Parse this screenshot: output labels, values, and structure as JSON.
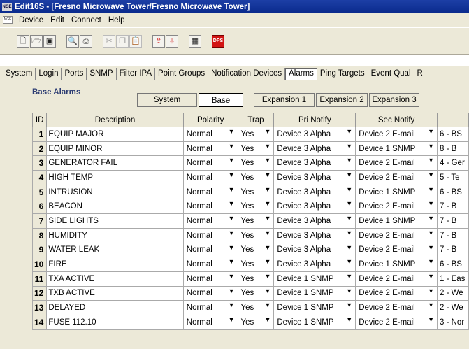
{
  "window": {
    "title": "Edit16S - [Fresno Microwave Tower/Fresno Microwave Tower]",
    "app_icon_text": "NGE"
  },
  "menu": {
    "icon_text": "NGE",
    "items": [
      "Device",
      "Edit",
      "Connect",
      "Help"
    ]
  },
  "toolbar": {
    "groups": [
      [
        {
          "icon": "new-file-icon",
          "glyph": "🗋"
        },
        {
          "icon": "open-folder-icon",
          "glyph": "🗁"
        },
        {
          "icon": "save-icon",
          "glyph": "▣"
        }
      ],
      [
        {
          "icon": "print-preview-icon",
          "glyph": "🔍"
        },
        {
          "icon": "print-icon",
          "glyph": "⎙"
        }
      ],
      [
        {
          "icon": "cut-icon",
          "glyph": "✂",
          "dim": true
        },
        {
          "icon": "copy-icon",
          "glyph": "❐",
          "dim": true
        },
        {
          "icon": "paste-icon",
          "glyph": "📋",
          "dim": true
        }
      ],
      [
        {
          "icon": "upload-icon",
          "glyph": "⇪",
          "red": true
        },
        {
          "icon": "download-icon",
          "glyph": "⇩",
          "red": true
        }
      ],
      [
        {
          "icon": "network-icon",
          "glyph": "▦"
        }
      ],
      [
        {
          "icon": "dps-logo-icon",
          "glyph": "DPS",
          "dps": true
        }
      ]
    ]
  },
  "tabs": [
    "System",
    "Login",
    "Ports",
    "SNMP",
    "Filter IPA",
    "Point Groups",
    "Notification Devices",
    "Alarms",
    "Ping Targets",
    "Event Qual",
    "R"
  ],
  "active_tab": "Alarms",
  "section_title": "Base Alarms",
  "segments": [
    "System",
    "Base",
    "Expansion 1",
    "Expansion 2",
    "Expansion 3"
  ],
  "active_segment": "Base",
  "columns": [
    "ID",
    "Description",
    "Polarity",
    "Trap",
    "Pri Notify",
    "Sec Notify",
    ""
  ],
  "rows": [
    {
      "id": "1",
      "desc": "EQUIP MAJOR",
      "polarity": "Normal",
      "trap": "Yes",
      "pri": "Device 3 Alpha",
      "sec": "Device 2 E-mail",
      "more": "6 - BS"
    },
    {
      "id": "2",
      "desc": "EQUIP MINOR",
      "polarity": "Normal",
      "trap": "Yes",
      "pri": "Device 3 Alpha",
      "sec": "Device 1 SNMP",
      "more": "8 - B"
    },
    {
      "id": "3",
      "desc": "GENERATOR FAIL",
      "polarity": "Normal",
      "trap": "Yes",
      "pri": "Device 3 Alpha",
      "sec": "Device 2 E-mail",
      "more": "4 - Ger"
    },
    {
      "id": "4",
      "desc": "HIGH TEMP",
      "polarity": "Normal",
      "trap": "Yes",
      "pri": "Device 3 Alpha",
      "sec": "Device 2 E-mail",
      "more": "5 - Te"
    },
    {
      "id": "5",
      "desc": "INTRUSION",
      "polarity": "Normal",
      "trap": "Yes",
      "pri": "Device 3 Alpha",
      "sec": "Device 1 SNMP",
      "more": "6 - BS"
    },
    {
      "id": "6",
      "desc": "BEACON",
      "polarity": "Normal",
      "trap": "Yes",
      "pri": "Device 3 Alpha",
      "sec": "Device 2 E-mail",
      "more": "7 - B"
    },
    {
      "id": "7",
      "desc": "SIDE LIGHTS",
      "polarity": "Normal",
      "trap": "Yes",
      "pri": "Device 3 Alpha",
      "sec": "Device 1 SNMP",
      "more": "7 - B"
    },
    {
      "id": "8",
      "desc": "HUMIDITY",
      "polarity": "Normal",
      "trap": "Yes",
      "pri": "Device 3 Alpha",
      "sec": "Device 2 E-mail",
      "more": "7 - B"
    },
    {
      "id": "9",
      "desc": "WATER LEAK",
      "polarity": "Normal",
      "trap": "Yes",
      "pri": "Device 3 Alpha",
      "sec": "Device 2 E-mail",
      "more": "7 - B"
    },
    {
      "id": "10",
      "desc": "FIRE",
      "polarity": "Normal",
      "trap": "Yes",
      "pri": "Device 3 Alpha",
      "sec": "Device 1 SNMP",
      "more": "6 - BS"
    },
    {
      "id": "11",
      "desc": "TXA ACTIVE",
      "polarity": "Normal",
      "trap": "Yes",
      "pri": "Device 1 SNMP",
      "sec": "Device 2 E-mail",
      "more": "1 - Eas"
    },
    {
      "id": "12",
      "desc": "TXB ACTIVE",
      "polarity": "Normal",
      "trap": "Yes",
      "pri": "Device 1 SNMP",
      "sec": "Device 2 E-mail",
      "more": "2 - We"
    },
    {
      "id": "13",
      "desc": "DELAYED",
      "polarity": "Normal",
      "trap": "Yes",
      "pri": "Device 1 SNMP",
      "sec": "Device 2 E-mail",
      "more": "2 - We"
    },
    {
      "id": "14",
      "desc": "FUSE 112.10",
      "polarity": "Normal",
      "trap": "Yes",
      "pri": "Device 1 SNMP",
      "sec": "Device 2 E-mail",
      "more": "3 - Nor"
    }
  ]
}
